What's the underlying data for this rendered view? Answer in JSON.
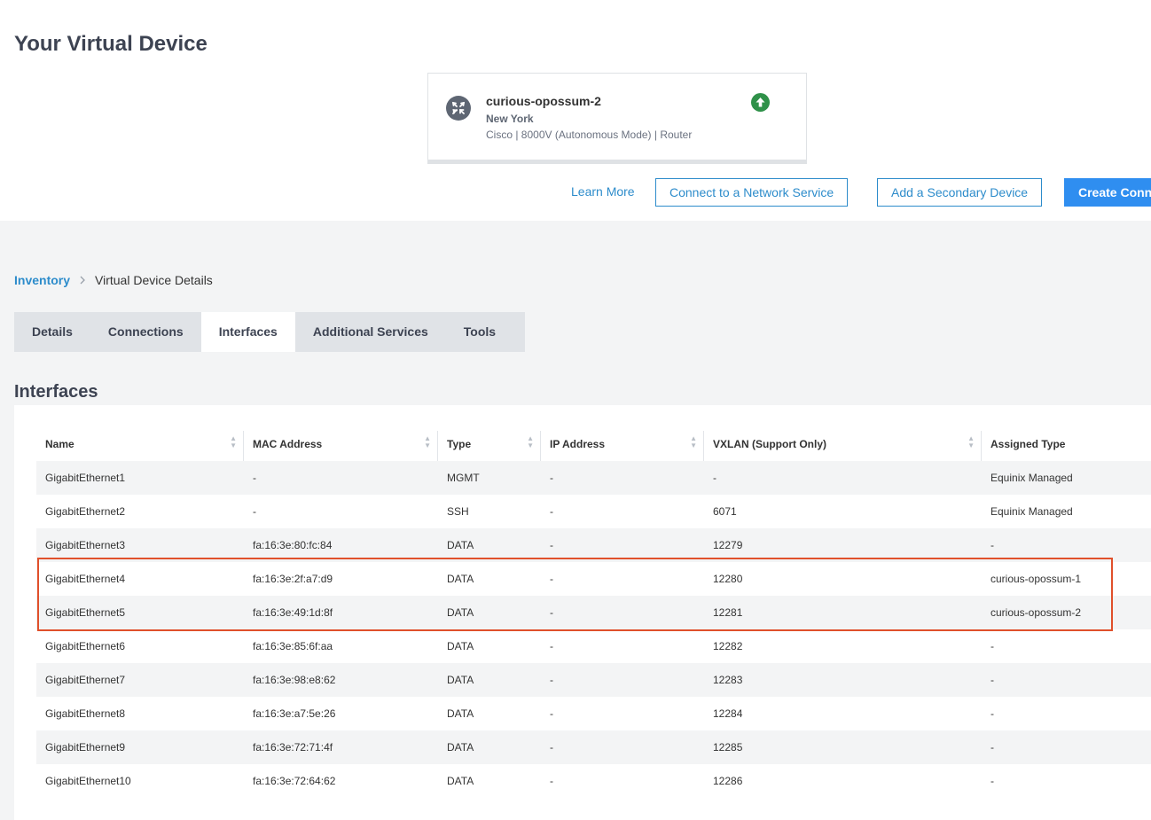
{
  "page": {
    "title": "Your Virtual Device"
  },
  "device": {
    "name": "curious-opossum-2",
    "location": "New York",
    "meta": "Cisco | 8000V (Autonomous Mode) | Router",
    "status_icon": "arrow-up-circle-icon",
    "status_color": "#2f9149"
  },
  "actions": {
    "learn_more": "Learn More",
    "connect_network_service": "Connect to a Network Service",
    "add_secondary_device": "Add a Secondary Device",
    "create_connection": "Create Conn"
  },
  "breadcrumb": {
    "parent": "Inventory",
    "separator": ">",
    "current": "Virtual Device Details"
  },
  "tabs": [
    {
      "label": "Details"
    },
    {
      "label": "Connections"
    },
    {
      "label": "Interfaces",
      "active": true
    },
    {
      "label": "Additional Services"
    },
    {
      "label": "Tools"
    }
  ],
  "section": {
    "title": "Interfaces"
  },
  "table": {
    "columns": [
      "Name",
      "MAC Address",
      "Type",
      "IP Address",
      "VXLAN (Support Only)",
      "Assigned Type"
    ],
    "rows": [
      [
        "GigabitEthernet1",
        "-",
        "MGMT",
        "-",
        "-",
        "Equinix Managed"
      ],
      [
        "GigabitEthernet2",
        "-",
        "SSH",
        "-",
        "6071",
        "Equinix Managed"
      ],
      [
        "GigabitEthernet3",
        "fa:16:3e:80:fc:84",
        "DATA",
        "-",
        "12279",
        "-"
      ],
      [
        "GigabitEthernet4",
        "fa:16:3e:2f:a7:d9",
        "DATA",
        "-",
        "12280",
        "curious-opossum-1"
      ],
      [
        "GigabitEthernet5",
        "fa:16:3e:49:1d:8f",
        "DATA",
        "-",
        "12281",
        "curious-opossum-2"
      ],
      [
        "GigabitEthernet6",
        "fa:16:3e:85:6f:aa",
        "DATA",
        "-",
        "12282",
        "-"
      ],
      [
        "GigabitEthernet7",
        "fa:16:3e:98:e8:62",
        "DATA",
        "-",
        "12283",
        "-"
      ],
      [
        "GigabitEthernet8",
        "fa:16:3e:a7:5e:26",
        "DATA",
        "-",
        "12284",
        "-"
      ],
      [
        "GigabitEthernet9",
        "fa:16:3e:72:71:4f",
        "DATA",
        "-",
        "12285",
        "-"
      ],
      [
        "GigabitEthernet10",
        "fa:16:3e:72:64:62",
        "DATA",
        "-",
        "12286",
        "-"
      ]
    ]
  },
  "colors": {
    "accent": "#2d8ccb",
    "primary_button": "#2f8ef0",
    "highlight_box": "#e0502b"
  }
}
